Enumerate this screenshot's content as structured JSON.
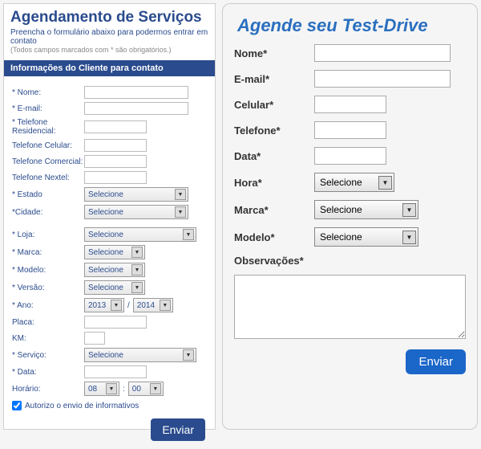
{
  "left": {
    "title": "Agendamento de Serviços",
    "subtitle": "Preencha o formulário abaixo para podermos entrar em contato",
    "note": "(Todos campos marcados com * são obrigatórios.)",
    "section_header": "Informações do Cliente para contato",
    "labels": {
      "nome": "* Nome:",
      "email": "* E-mail:",
      "tel_res": "* Telefone Residencial:",
      "tel_cel": "Telefone Celular:",
      "tel_com": "Telefone Comercial:",
      "tel_nextel": "Telefone Nextel:",
      "estado": "* Estado",
      "cidade": "*Cidade:",
      "loja": "* Loja:",
      "marca": "* Marca:",
      "modelo": "* Modelo:",
      "versao": "* Versão:",
      "ano": "* Ano:",
      "placa": "Placa:",
      "km": "KM:",
      "servico": "* Serviço:",
      "data": "* Data:",
      "horario": "Horário:"
    },
    "selects": {
      "selecione": "Selecione",
      "ano1": "2013",
      "ano2": "2014",
      "h1": "08",
      "h2": "00"
    },
    "ano_sep": "/",
    "hora_sep": ":",
    "checkbox_label": "Autorizo o envio de informativos",
    "checkbox_checked": true,
    "submit": "Enviar"
  },
  "right": {
    "title": "Agende seu Test-Drive",
    "labels": {
      "nome": "Nome*",
      "email": "E-mail*",
      "celular": "Celular*",
      "telefone": "Telefone*",
      "data": "Data*",
      "hora": "Hora*",
      "marca": "Marca*",
      "modelo": "Modelo*",
      "obs": "Observações*"
    },
    "selects": {
      "selecione": "Selecione"
    },
    "submit": "Enviar"
  }
}
